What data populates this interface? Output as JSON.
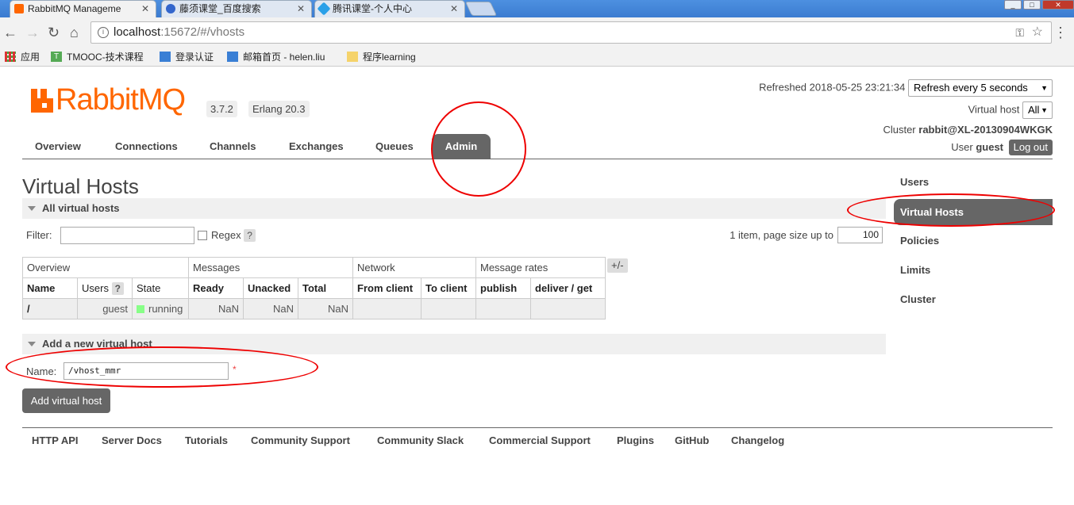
{
  "browser": {
    "tabs": [
      {
        "title": "RabbitMQ Manageme",
        "active": true
      },
      {
        "title": "藤须课堂_百度搜索",
        "active": false
      },
      {
        "title": "腾讯课堂-个人中心",
        "active": false
      }
    ],
    "url_host": "localhost",
    "url_path": ":15672/#/vhosts",
    "bookmarks": [
      "应用",
      "TMOOC-技术课程",
      "登录认证",
      "邮箱首页 - helen.liu",
      "程序learning"
    ]
  },
  "header": {
    "logo_text": "RabbitMQ",
    "version": "3.7.2",
    "erlang": "Erlang 20.3",
    "refreshed_label": "Refreshed 2018-05-25 23:21:34",
    "refresh_select": "Refresh every 5 seconds",
    "vhost_label": "Virtual host",
    "vhost_select": "All",
    "cluster_label": "Cluster",
    "cluster_name": "rabbit@XL-20130904WKGK",
    "user_label": "User",
    "user_name": "guest",
    "logout": "Log out"
  },
  "nav": {
    "tabs": [
      "Overview",
      "Connections",
      "Channels",
      "Exchanges",
      "Queues",
      "Admin"
    ],
    "active": "Admin"
  },
  "main": {
    "title": "Virtual Hosts",
    "all_section": "All virtual hosts",
    "filter_label": "Filter:",
    "filter_value": "",
    "regex_label": "Regex",
    "help": "?",
    "page_info": "1 item, page size up to",
    "page_size": "100",
    "table": {
      "groups": [
        "Overview",
        "Messages",
        "Network",
        "Message rates"
      ],
      "columns": [
        "Name",
        "Users",
        "State",
        "Ready",
        "Unacked",
        "Total",
        "From client",
        "To client",
        "publish",
        "deliver / get"
      ],
      "rows": [
        {
          "name": "/",
          "users": "guest",
          "state": "running",
          "ready": "NaN",
          "unacked": "NaN",
          "total": "NaN",
          "from_client": "",
          "to_client": "",
          "publish": "",
          "deliver": ""
        }
      ],
      "plus_minus": "+/-"
    },
    "add_section": "Add a new virtual host",
    "name_label": "Name:",
    "name_value": "/vhost_mmr",
    "required": "*",
    "add_button": "Add virtual host"
  },
  "sidebar": {
    "items": [
      "Users",
      "Virtual Hosts",
      "Policies",
      "Limits",
      "Cluster"
    ],
    "active": "Virtual Hosts"
  },
  "footer": {
    "links": [
      "HTTP API",
      "Server Docs",
      "Tutorials",
      "Community Support",
      "Community Slack",
      "Commercial Support",
      "Plugins",
      "GitHub",
      "Changelog"
    ]
  },
  "colors": {
    "brand_orange": "#ff6600",
    "active_tab": "#666666",
    "annotation_red": "#ee0000"
  }
}
